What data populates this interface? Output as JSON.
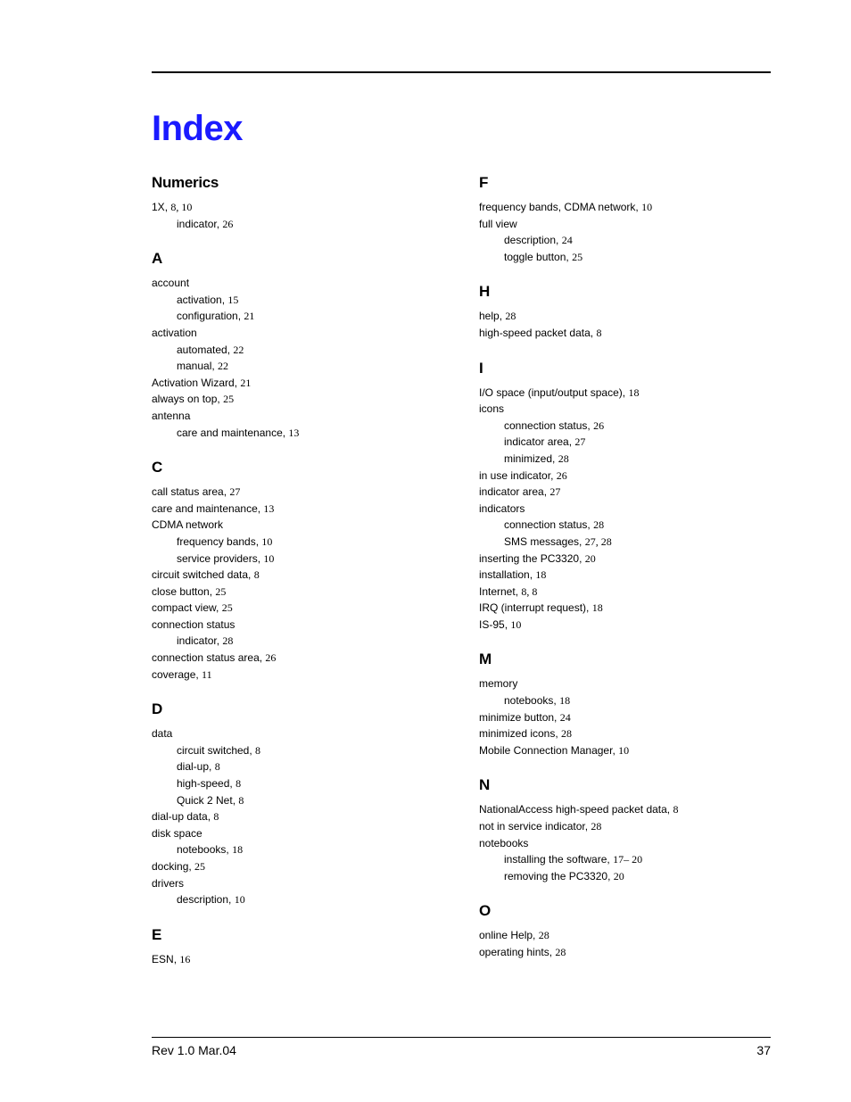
{
  "title": "Index",
  "footer": {
    "left": "Rev 1.0  Mar.04",
    "right": "37"
  },
  "left_sections": [
    {
      "head": "Numerics",
      "lines": [
        {
          "t": "1X",
          "p": "8,  10"
        },
        {
          "t": "indicator",
          "p": "26",
          "sub": true
        }
      ]
    },
    {
      "head": "A",
      "lines": [
        {
          "t": "account"
        },
        {
          "t": "activation",
          "p": "15",
          "sub": true
        },
        {
          "t": "configuration",
          "p": "21",
          "sub": true
        },
        {
          "t": "activation"
        },
        {
          "t": "automated",
          "p": "22",
          "sub": true
        },
        {
          "t": "manual",
          "p": "22",
          "sub": true
        },
        {
          "t": "Activation Wizard",
          "p": "21"
        },
        {
          "t": "always on top",
          "p": "25"
        },
        {
          "t": "antenna"
        },
        {
          "t": "care and maintenance",
          "p": "13",
          "sub": true
        }
      ]
    },
    {
      "head": "C",
      "lines": [
        {
          "t": "call status area",
          "p": "27"
        },
        {
          "t": "care and maintenance",
          "p": "13"
        },
        {
          "t": "CDMA network"
        },
        {
          "t": "frequency bands",
          "p": "10",
          "sub": true
        },
        {
          "t": "service providers",
          "p": "10",
          "sub": true
        },
        {
          "t": "circuit switched data",
          "p": "8"
        },
        {
          "t": "close button",
          "p": "25"
        },
        {
          "t": "compact view",
          "p": "25"
        },
        {
          "t": "connection status"
        },
        {
          "t": "indicator",
          "p": "28",
          "sub": true
        },
        {
          "t": "connection status area",
          "p": "26"
        },
        {
          "t": "coverage",
          "p": "11"
        }
      ]
    },
    {
      "head": "D",
      "lines": [
        {
          "t": "data"
        },
        {
          "t": "circuit switched",
          "p": "8",
          "sub": true
        },
        {
          "t": "dial-up",
          "p": "8",
          "sub": true
        },
        {
          "t": "high-speed",
          "p": "8",
          "sub": true
        },
        {
          "t": "Quick 2 Net",
          "p": "8",
          "sub": true
        },
        {
          "t": "dial-up data",
          "p": "8"
        },
        {
          "t": "disk space"
        },
        {
          "t": "notebooks",
          "p": "18",
          "sub": true
        },
        {
          "t": "docking",
          "p": "25"
        },
        {
          "t": "drivers"
        },
        {
          "t": "description",
          "p": "10",
          "sub": true
        }
      ]
    },
    {
      "head": "E",
      "lines": [
        {
          "t": "ESN",
          "p": "16"
        }
      ]
    }
  ],
  "right_sections": [
    {
      "head": "F",
      "lines": [
        {
          "t": "frequency bands, CDMA network",
          "p": "10"
        },
        {
          "t": "full view"
        },
        {
          "t": "description",
          "p": "24",
          "sub": true
        },
        {
          "t": "toggle button",
          "p": "25",
          "sub": true
        }
      ]
    },
    {
      "head": "H",
      "lines": [
        {
          "t": "help",
          "p": "28"
        },
        {
          "t": "high-speed packet data",
          "p": "8"
        }
      ]
    },
    {
      "head": "I",
      "lines": [
        {
          "t": "I/O space (input/output space)",
          "p": "18"
        },
        {
          "t": "icons"
        },
        {
          "t": "connection status",
          "p": "26",
          "sub": true
        },
        {
          "t": "indicator area",
          "p": "27",
          "sub": true
        },
        {
          "t": "minimized",
          "p": "28",
          "sub": true
        },
        {
          "t": "in use indicator",
          "p": "26"
        },
        {
          "t": "indicator area",
          "p": "27"
        },
        {
          "t": "indicators"
        },
        {
          "t": "connection status",
          "p": "28",
          "sub": true
        },
        {
          "t": "SMS messages",
          "p": "27,  28",
          "sub": true
        },
        {
          "t": "inserting the PC3320",
          "p": "20"
        },
        {
          "t": "installation",
          "p": "18"
        },
        {
          "t": "Internet",
          "p": "8,  8"
        },
        {
          "t": "IRQ (interrupt request)",
          "p": "18"
        },
        {
          "t": "IS-95",
          "p": "10"
        }
      ]
    },
    {
      "head": "M",
      "lines": [
        {
          "t": "memory"
        },
        {
          "t": "notebooks",
          "p": "18",
          "sub": true
        },
        {
          "t": "minimize button",
          "p": "24"
        },
        {
          "t": "minimized icons",
          "p": "28"
        },
        {
          "t": "Mobile Connection Manager",
          "p": "10"
        }
      ]
    },
    {
      "head": "N",
      "lines": [
        {
          "t": "NationalAccess high-speed packet data",
          "p": "8"
        },
        {
          "t": "not in service indicator",
          "p": "28"
        },
        {
          "t": "notebooks"
        },
        {
          "t": "installing the software",
          "p": "17– 20",
          "sub": true
        },
        {
          "t": "removing the PC3320",
          "p": "20",
          "sub": true
        }
      ]
    },
    {
      "head": "O",
      "lines": [
        {
          "t": "online Help",
          "p": "28"
        },
        {
          "t": "operating hints",
          "p": "28"
        }
      ]
    }
  ]
}
